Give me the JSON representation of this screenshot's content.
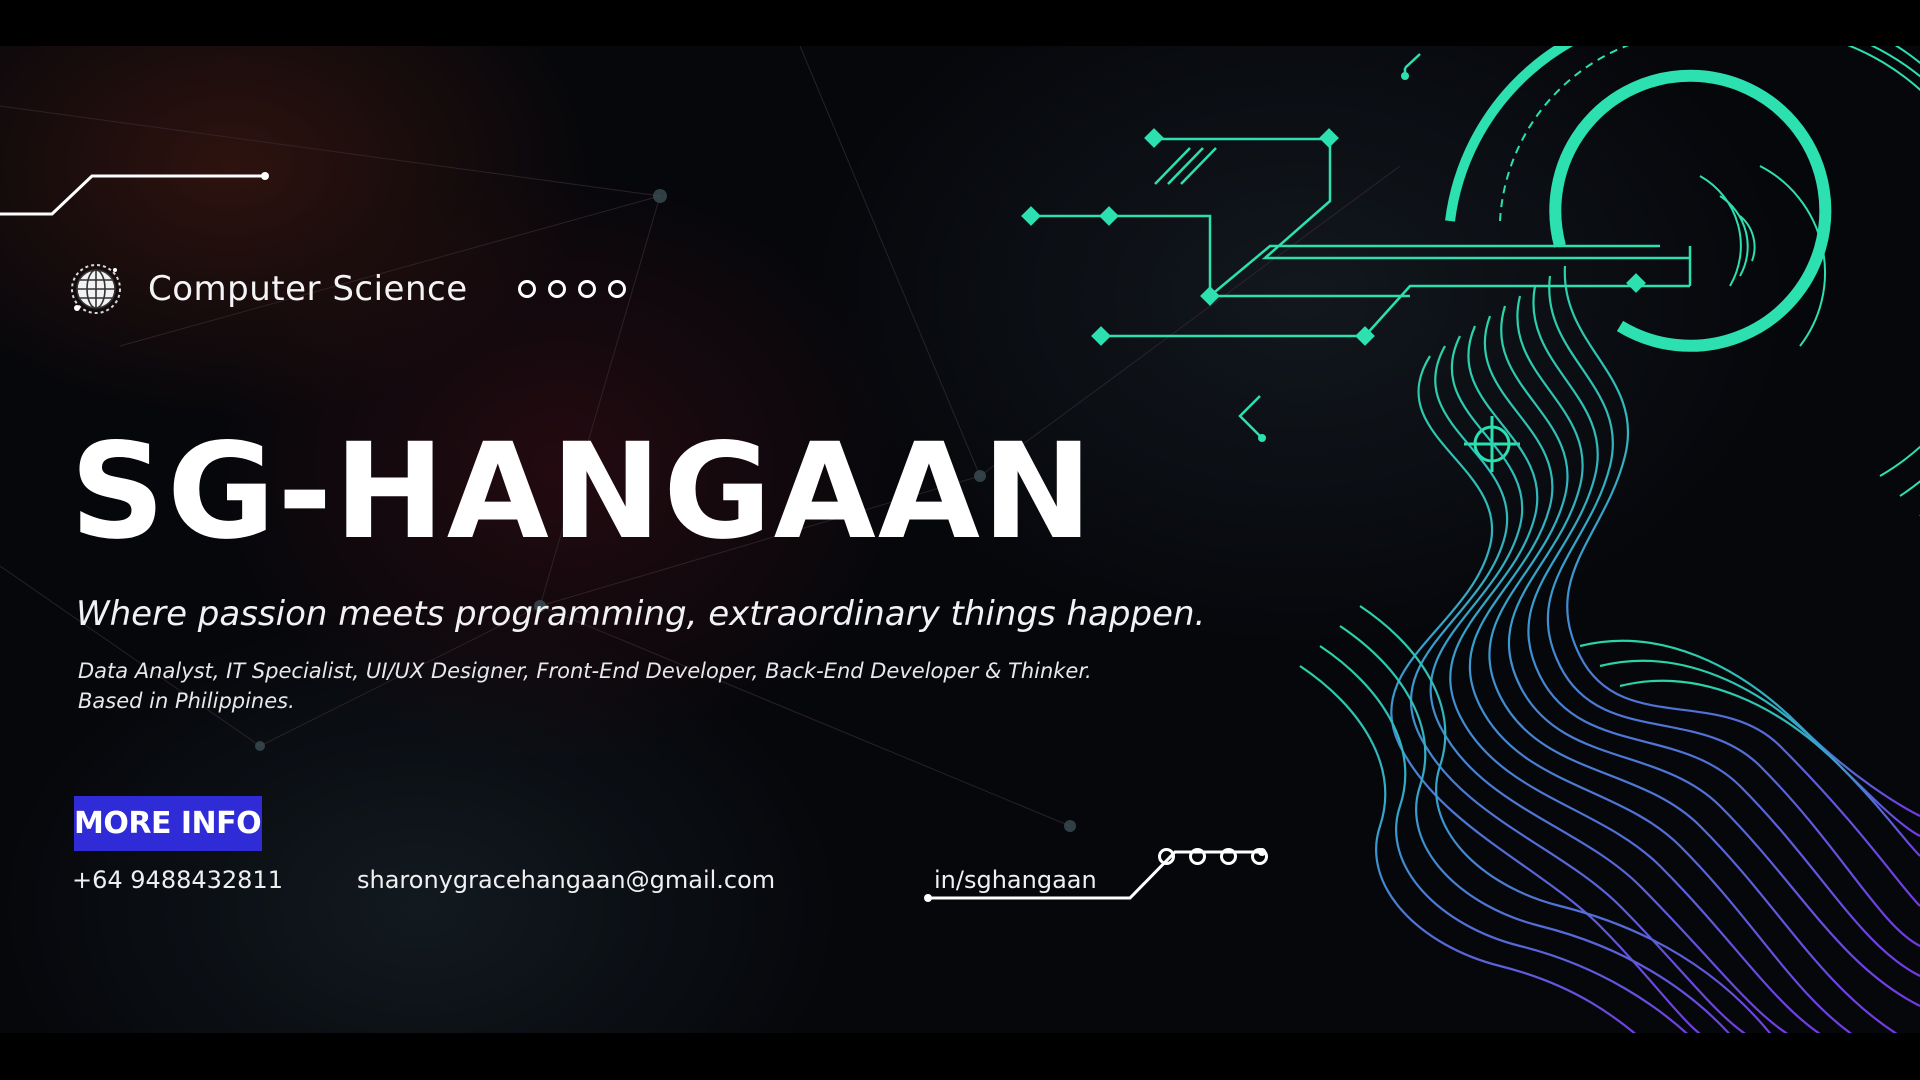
{
  "header": {
    "category": "Computer Science",
    "title": "SG-HANGAAN"
  },
  "main": {
    "tagline": "Where passion meets programming, extraordinary things happen.",
    "roles_line1": "Data Analyst, IT Specialist, UI/UX Designer, Front-End Developer, Back-End Developer & Thinker.",
    "roles_line2": "Based in Philippines."
  },
  "cta": {
    "label": "MORE INFO"
  },
  "contact": {
    "phone": "+64 9488432811",
    "email": "sharonygracehangaan@gmail.com",
    "linkedin": "in/sghangaan"
  },
  "icons": [
    "globe-icon",
    "circuit-graphic",
    "waveform-graphic"
  ],
  "colors": {
    "accent_green": "#2de0b0",
    "accent_blue": "#2f2bd6",
    "wave_purple": "#7a3cf0",
    "background": "#06070b"
  }
}
